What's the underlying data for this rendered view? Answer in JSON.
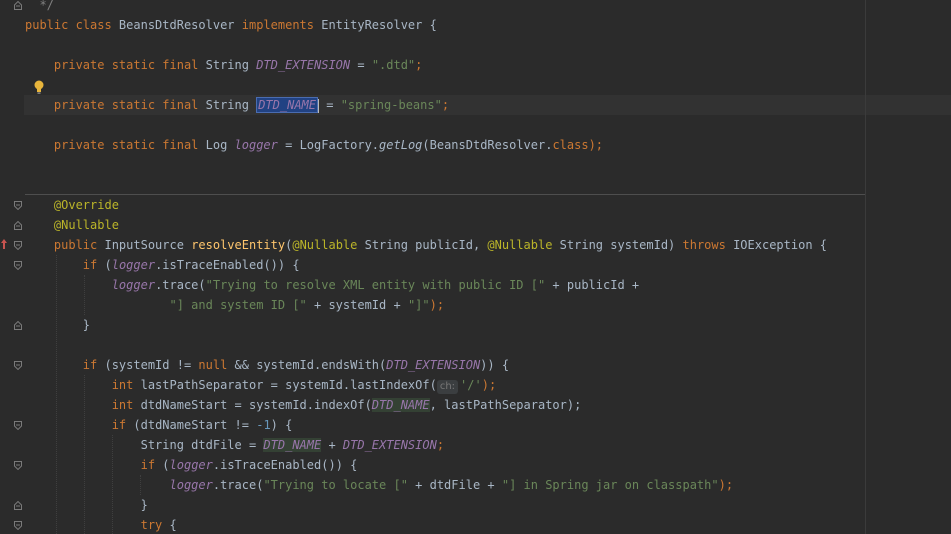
{
  "editor": {
    "lines": [
      {
        "name": "comment-end",
        "tokens": [
          {
            "t": "  */",
            "c": "cmt"
          }
        ]
      },
      {
        "name": "class-declaration",
        "tokens": [
          {
            "t": "public class ",
            "c": "kw"
          },
          {
            "t": "BeansDtdResolver "
          },
          {
            "t": "implements ",
            "c": "kw"
          },
          {
            "t": "EntityResolver {"
          }
        ]
      },
      {
        "name": "blank",
        "tokens": []
      },
      {
        "name": "dtd-extension-field",
        "tokens": [
          {
            "t": "    private static final ",
            "c": "kw"
          },
          {
            "t": "String "
          },
          {
            "t": "DTD_EXTENSION",
            "c": "const"
          },
          {
            "t": " = "
          },
          {
            "t": "\".dtd\"",
            "c": "str"
          },
          {
            "t": ";",
            "c": "kw"
          }
        ]
      },
      {
        "name": "blank",
        "tokens": []
      },
      {
        "name": "dtd-name-field",
        "tokens": [
          {
            "t": "    private static final ",
            "c": "kw"
          },
          {
            "t": "String "
          },
          {
            "t": "DTD_NAME",
            "c": "const sel"
          },
          {
            "t": "",
            "c": "caret"
          },
          {
            "t": " = "
          },
          {
            "t": "\"spring-beans\"",
            "c": "str"
          },
          {
            "t": ";",
            "c": "kw"
          }
        ]
      },
      {
        "name": "blank",
        "tokens": []
      },
      {
        "name": "logger-field",
        "tokens": [
          {
            "t": "    private static final ",
            "c": "kw"
          },
          {
            "t": "Log "
          },
          {
            "t": "logger",
            "c": "field"
          },
          {
            "t": " = LogFactory."
          },
          {
            "t": "getLog",
            "c": "static-call"
          },
          {
            "t": "(BeansDtdResolver."
          },
          {
            "t": "class",
            "c": "kw"
          },
          {
            "t": ");",
            "c": "kw"
          }
        ]
      },
      {
        "name": "blank",
        "tokens": []
      },
      {
        "name": "blank",
        "tokens": []
      },
      {
        "name": "override-annotation",
        "tokens": [
          {
            "t": "    @Override",
            "c": "ann"
          }
        ]
      },
      {
        "name": "nullable-annotation",
        "tokens": [
          {
            "t": "    @Nullable",
            "c": "ann"
          }
        ]
      },
      {
        "name": "resolve-entity-signature",
        "tokens": [
          {
            "t": "    public ",
            "c": "kw"
          },
          {
            "t": "InputSource "
          },
          {
            "t": "resolveEntity",
            "c": "fn"
          },
          {
            "t": "("
          },
          {
            "t": "@Nullable ",
            "c": "ann"
          },
          {
            "t": "String publicId, "
          },
          {
            "t": "@Nullable ",
            "c": "ann"
          },
          {
            "t": "String systemId) "
          },
          {
            "t": "throws ",
            "c": "kw"
          },
          {
            "t": "IOException {"
          }
        ]
      },
      {
        "name": "if-trace-enabled",
        "tokens": [
          {
            "t": "        if ",
            "c": "kw"
          },
          {
            "t": "("
          },
          {
            "t": "logger",
            "c": "field"
          },
          {
            "t": ".isTraceEnabled()) {"
          }
        ]
      },
      {
        "name": "logger-trace-1",
        "tokens": [
          {
            "t": "            "
          },
          {
            "t": "logger",
            "c": "field"
          },
          {
            "t": ".trace("
          },
          {
            "t": "\"Trying to resolve XML entity with public ID [\"",
            "c": "str"
          },
          {
            "t": " + publicId +"
          }
        ]
      },
      {
        "name": "logger-trace-1-cont",
        "tokens": [
          {
            "t": "                    "
          },
          {
            "t": "\"] and system ID [\"",
            "c": "str"
          },
          {
            "t": " + systemId + "
          },
          {
            "t": "\"]\"",
            "c": "str"
          },
          {
            "t": ");",
            "c": "kw"
          }
        ]
      },
      {
        "name": "close-brace",
        "tokens": [
          {
            "t": "        }"
          }
        ]
      },
      {
        "name": "blank",
        "tokens": []
      },
      {
        "name": "if-system-id",
        "tokens": [
          {
            "t": "        if ",
            "c": "kw"
          },
          {
            "t": "(systemId != "
          },
          {
            "t": "null ",
            "c": "kw"
          },
          {
            "t": "&& systemId.endsWith("
          },
          {
            "t": "DTD_EXTENSION",
            "c": "const"
          },
          {
            "t": ")) {"
          }
        ]
      },
      {
        "name": "last-path-separator",
        "tokens": [
          {
            "t": "            "
          },
          {
            "t": "int ",
            "c": "kw"
          },
          {
            "t": "lastPathSeparator = systemId.lastIndexOf("
          },
          {
            "t": "ch:",
            "c": "hint"
          },
          {
            "t": "'/'",
            "c": "str"
          },
          {
            "t": ");",
            "c": "kw"
          }
        ]
      },
      {
        "name": "dtd-name-start",
        "tokens": [
          {
            "t": "            "
          },
          {
            "t": "int ",
            "c": "kw"
          },
          {
            "t": "dtdNameStart = systemId.indexOf("
          },
          {
            "t": "DTD_NAME",
            "c": "const hl-usage"
          },
          {
            "t": ", lastPathSeparator);"
          }
        ]
      },
      {
        "name": "if-dtd-name-start",
        "tokens": [
          {
            "t": "            "
          },
          {
            "t": "if ",
            "c": "kw"
          },
          {
            "t": "(dtdNameStart != "
          },
          {
            "t": "-1",
            "c": "num"
          },
          {
            "t": ") {"
          }
        ]
      },
      {
        "name": "dtd-file",
        "tokens": [
          {
            "t": "                String dtdFile = "
          },
          {
            "t": "DTD_NAME",
            "c": "const hl-usage"
          },
          {
            "t": " + "
          },
          {
            "t": "DTD_EXTENSION",
            "c": "const"
          },
          {
            "t": ";",
            "c": "kw"
          }
        ]
      },
      {
        "name": "if-trace-enabled-2",
        "tokens": [
          {
            "t": "                "
          },
          {
            "t": "if ",
            "c": "kw"
          },
          {
            "t": "("
          },
          {
            "t": "logger",
            "c": "field"
          },
          {
            "t": ".isTraceEnabled()) {"
          }
        ]
      },
      {
        "name": "logger-trace-2",
        "tokens": [
          {
            "t": "                    "
          },
          {
            "t": "logger",
            "c": "field"
          },
          {
            "t": ".trace("
          },
          {
            "t": "\"Trying to locate [\"",
            "c": "str"
          },
          {
            "t": " + dtdFile + "
          },
          {
            "t": "\"] in Spring jar on classpath\"",
            "c": "str"
          },
          {
            "t": ");",
            "c": "kw"
          }
        ]
      },
      {
        "name": "close-brace",
        "tokens": [
          {
            "t": "                }"
          }
        ]
      },
      {
        "name": "try-block",
        "tokens": [
          {
            "t": "                "
          },
          {
            "t": "try ",
            "c": "kw"
          },
          {
            "t": "{"
          }
        ]
      }
    ]
  }
}
